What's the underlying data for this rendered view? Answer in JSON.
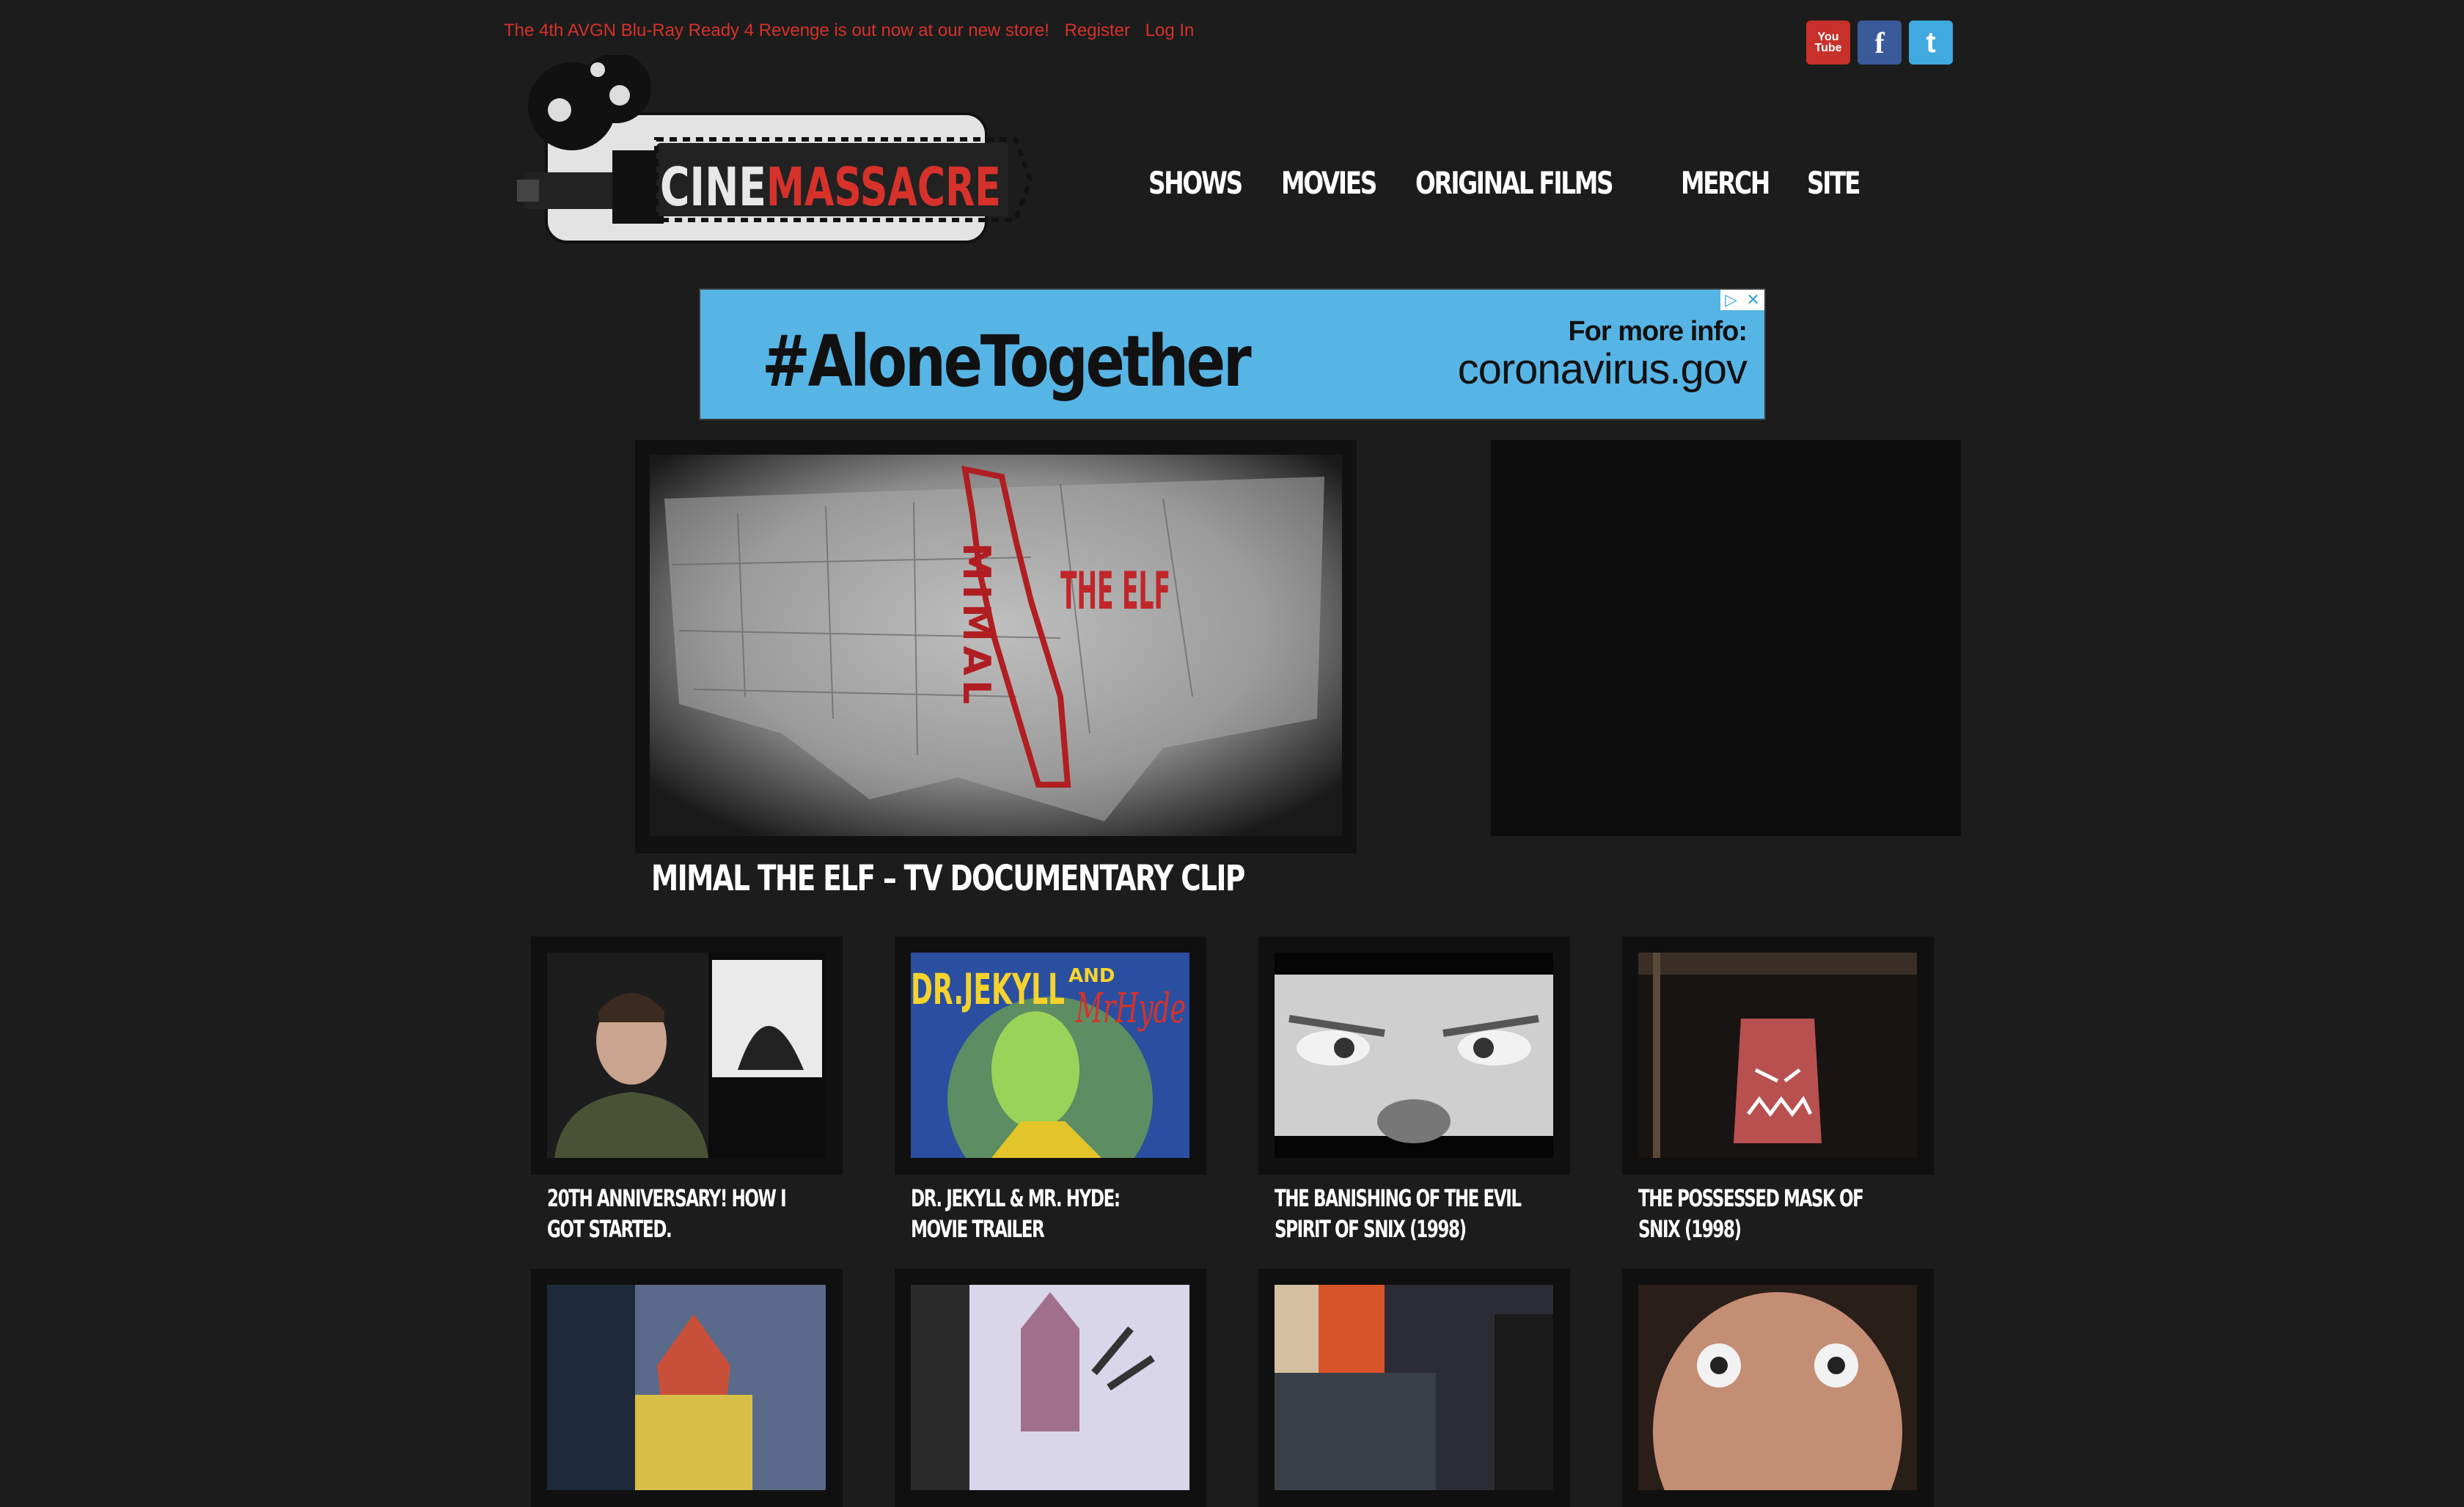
{
  "topbar": {
    "promo": "The 4th AVGN Blu-Ray Ready 4 Revenge is out now at our new store!",
    "register": "Register",
    "login": "Log In"
  },
  "social": [
    "youtube-icon",
    "facebook-icon",
    "twitter-icon"
  ],
  "logo": {
    "text_a": "CINE",
    "text_b": "MASSACRE"
  },
  "nav": [
    "SHOWS",
    "MOVIES",
    "ORIGINAL FILMS",
    "MERCH",
    "SITE"
  ],
  "ad": {
    "tag": "#AloneTogether",
    "info_line1": "For more info:",
    "info_line2": "coronavirus.gov"
  },
  "feature": {
    "title": "MIMAL THE ELF – TV DOCUMENTARY CLIP",
    "art_word1": "MIMAL",
    "art_word2": "THE ELF"
  },
  "videos": [
    {
      "title": "20TH ANNIVERSARY! HOW I GOT STARTED."
    },
    {
      "title": "DR. JEKYLL & MR. HYDE: MOVIE TRAILER",
      "art_a": "DR.JEKYLL",
      "art_and": "AND",
      "art_b": "MrHyde"
    },
    {
      "title": "THE BANISHING OF THE EVIL SPIRIT OF SNIX (1998)"
    },
    {
      "title": "THE POSSESSED MASK OF SNIX (1998)"
    },
    {
      "title": ""
    },
    {
      "title": ""
    },
    {
      "title": ""
    },
    {
      "title": ""
    }
  ],
  "colors": {
    "background": "#1c1c1c",
    "accent": "#d6322b",
    "ad_blue": "#57b5e6"
  }
}
